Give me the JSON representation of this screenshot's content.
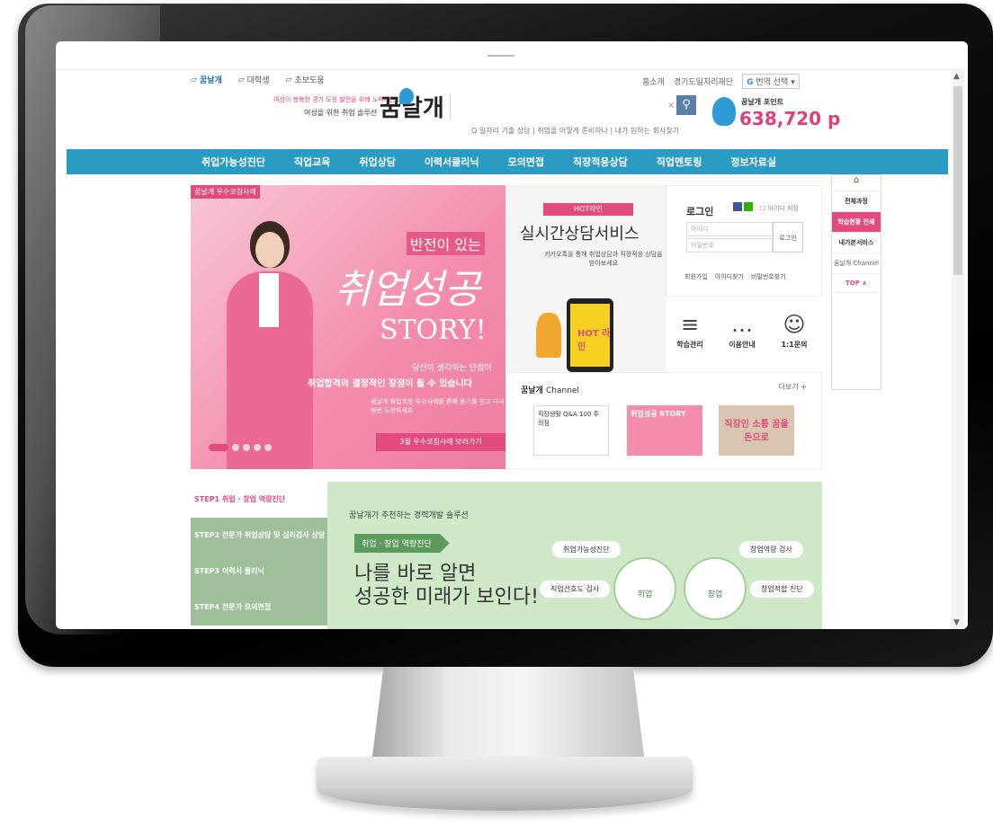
{
  "util": {
    "tabs": [
      "꿈날개",
      "대학생",
      "초보도움"
    ],
    "right_links": [
      "홈소개",
      "경기도일자리재단"
    ],
    "translate": "번역 선택"
  },
  "logo": {
    "tagline": "여성이 행복한 경기 도정 발전을 위해 노력하는",
    "subtitle": "여성을 위한 취업 솔루션",
    "name": "꿈날개"
  },
  "search": {
    "keywords": "Q 일자리 기출 상담 | 취업을 어떻게 준비하나 | 내가 원하는 회사찾기"
  },
  "points": {
    "label": "꿈날개 포인트",
    "value": "638,720 p"
  },
  "gnb": [
    "취업가능성진단",
    "직업교육",
    "취업상담",
    "이력서클리닉",
    "모의면접",
    "직장적응상담",
    "직업멘토링",
    "정보자료실"
  ],
  "hero": {
    "tag": "꿈날개 우수코칭사례",
    "headline1": "반전이 있는",
    "headline2": "취업성공",
    "headline3": "STORY!",
    "sub1": "당신이 생각하는 단점이",
    "sub2": "취업합격의 결정적인 장점이 될 수 있습니다",
    "sub3": "꿈날개 취업코칭 우수사례를 통해 용기를 얻고 다시 한번 도전하세요",
    "cta": "3월 우수코칭사례 보러가기"
  },
  "hot": {
    "badge": "HOT라인",
    "title": "실시간상담서비스",
    "desc": "카카오톡을 통해 취업상담과 직장적응 상담을 받아보세요",
    "phone": "HOT 라인"
  },
  "login": {
    "title": "로그인",
    "save": "아이디 저장",
    "id_ph": "아이디",
    "pw_ph": "비밀번호",
    "button": "로그인",
    "links": [
      "회원가입",
      "아이디찾기",
      "비밀번호찾기"
    ]
  },
  "services": [
    {
      "icon": "≡",
      "label": "학습관리"
    },
    {
      "icon": "…",
      "label": "이용안내"
    },
    {
      "icon": "☺",
      "label": "1:1문의"
    }
  ],
  "channel": {
    "title": "꿈날개",
    "title2": "Channel",
    "more": "더보기 +",
    "items": [
      "직장생활 Q&A 100 주의점",
      "취업성공 STORY",
      "직장인 소통 꿈을 돈으로"
    ]
  },
  "quick": {
    "items": [
      "전체과정",
      "학습현황 인쇄",
      "내가본서비스",
      "꿈날개 Channel"
    ],
    "top": "TOP ∧"
  },
  "steps": [
    "STEP1 취업 · 창업 역량진단",
    "STEP2 전문가 취업상담 및 심리검사 상담",
    "STEP3 이력서 클리닉",
    "STEP4 전문가 모의면접"
  ],
  "green": {
    "sub": "꿈날개가 추천하는 경력개발 솔루션",
    "pill": "취업 · 창업 역량진단",
    "line1": "나를 바로 알면",
    "line2": "성공한 미래가 보인다!",
    "bubbles": [
      "취업가능성진단",
      "창업역량 검사",
      "직업선호도 검사",
      "창업적합 진단"
    ],
    "circles": [
      "취업",
      "창업"
    ]
  }
}
